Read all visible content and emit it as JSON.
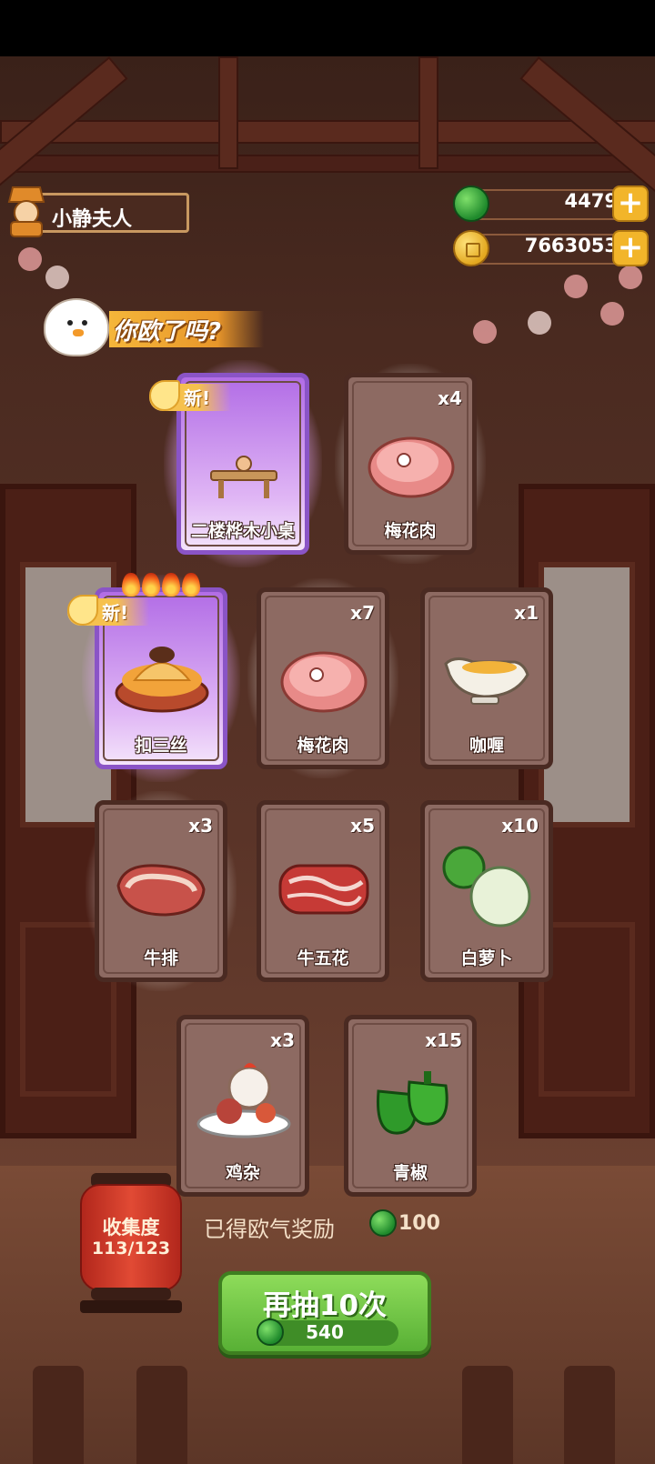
{
  "player": {
    "name": "小静夫人"
  },
  "currency": {
    "jade": "4479",
    "gold": "7663053"
  },
  "banner": {
    "text": "你欧了吗?"
  },
  "cards": [
    {
      "name": "二楼桦木小桌",
      "qty": "",
      "is_new": true,
      "rarity": "special",
      "icon": "table-icon"
    },
    {
      "name": "梅花肉",
      "qty": "x4",
      "is_new": false,
      "rarity": "normal",
      "icon": "pork-icon"
    },
    {
      "name": "扣三丝",
      "qty": "",
      "is_new": true,
      "rarity": "special",
      "icon": "dish-icon"
    },
    {
      "name": "梅花肉",
      "qty": "x7",
      "is_new": false,
      "rarity": "normal",
      "icon": "pork-icon"
    },
    {
      "name": "咖喱",
      "qty": "x1",
      "is_new": false,
      "rarity": "normal",
      "icon": "curry-icon"
    },
    {
      "name": "牛排",
      "qty": "x3",
      "is_new": false,
      "rarity": "normal",
      "icon": "steak-icon"
    },
    {
      "name": "牛五花",
      "qty": "x5",
      "is_new": false,
      "rarity": "normal",
      "icon": "beef-belly-icon"
    },
    {
      "name": "白萝卜",
      "qty": "x10",
      "is_new": false,
      "rarity": "normal",
      "icon": "radish-icon"
    },
    {
      "name": "鸡杂",
      "qty": "x3",
      "is_new": false,
      "rarity": "normal",
      "icon": "chicken-giblets-icon"
    },
    {
      "name": "青椒",
      "qty": "x15",
      "is_new": false,
      "rarity": "normal",
      "icon": "green-pepper-icon"
    }
  ],
  "new_badge": "新!",
  "collection": {
    "label": "收集度",
    "count": "113/123"
  },
  "reward": {
    "label": "已得欧气奖励",
    "value": "100"
  },
  "draw": {
    "label": "再抽10次",
    "cost": "540"
  },
  "colors": {
    "jade": "#2a9a36",
    "gold": "#f2b52a",
    "button_green": "#58b035",
    "special_purple": "#b26de6"
  }
}
